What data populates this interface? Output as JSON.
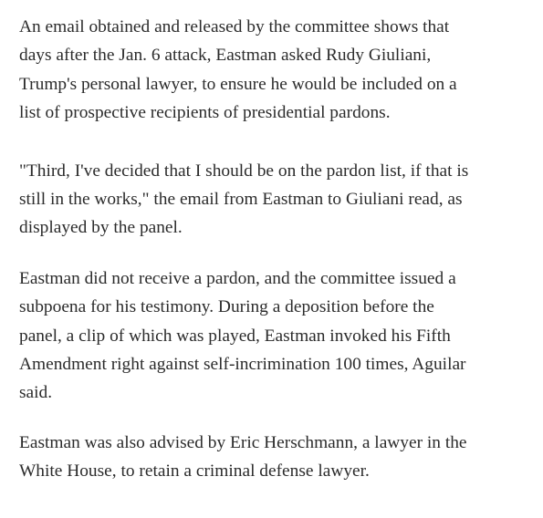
{
  "article": {
    "paragraphs": [
      {
        "lines": [
          "An email obtained and released by the committee shows that",
          "days after the Jan. 6 attack, Eastman asked Rudy Giuliani,",
          "Trump's personal lawyer, to ensure he would be included on a",
          "list of prospective recipients of presidential pardons."
        ]
      },
      {
        "lines": [
          "\"Third, I've decided that I should be on the pardon list, if that is",
          "still in the works,\" the email from Eastman to Giuliani read, as",
          "displayed by the panel."
        ]
      },
      {
        "lines": [
          "Eastman did not receive a pardon, and the committee issued a",
          "subpoena for his testimony. During a deposition before the",
          "panel, a clip of which was played, Eastman invoked his Fifth",
          "Amendment right against self-incrimination 100 times, Aguilar",
          "said."
        ]
      },
      {
        "lines": [
          "Eastman was also advised by Eric Herschmann, a lawyer in the",
          "White House, to retain a criminal defense lawyer."
        ]
      }
    ]
  }
}
